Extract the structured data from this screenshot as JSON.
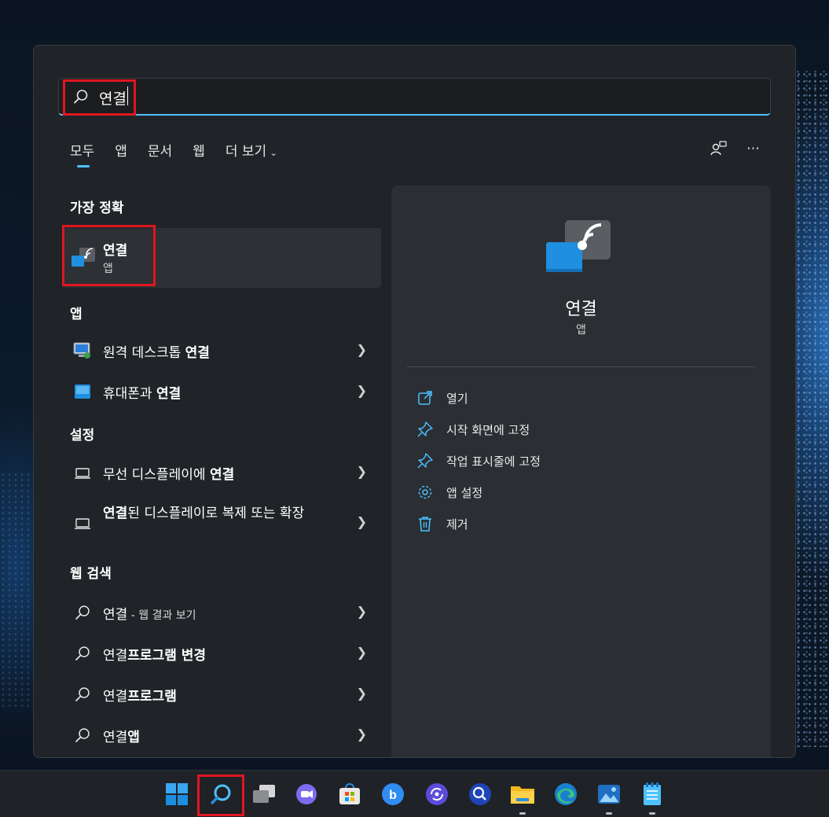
{
  "search": {
    "query": "연결"
  },
  "tabs": [
    {
      "label": "모두"
    },
    {
      "label": "앱"
    },
    {
      "label": "문서"
    },
    {
      "label": "웹"
    },
    {
      "label": "더 보기"
    }
  ],
  "best_match": {
    "heading": "가장 정확",
    "title": "연결",
    "subtitle": "앱"
  },
  "apps": {
    "heading": "앱",
    "items": [
      {
        "prefix": "원격 데스크톱 ",
        "bold": "연결"
      },
      {
        "prefix": "휴대폰과 ",
        "bold": "연결"
      }
    ]
  },
  "settings": {
    "heading": "설정",
    "items": [
      {
        "prefix": "무선 디스플레이에 ",
        "bold": "연결",
        "suffix": ""
      },
      {
        "prefix": "",
        "bold": "연결",
        "suffix": "된 디스플레이로 복제 또는 확장"
      }
    ]
  },
  "web": {
    "heading": "웹 검색",
    "items": [
      {
        "prefix": "연결",
        "bold": "",
        "small": " - 웹 결과 보기"
      },
      {
        "prefix": "연결",
        "bold": "프로그램 변경",
        "small": ""
      },
      {
        "prefix": "연결",
        "bold": "프로그램",
        "small": ""
      },
      {
        "prefix": "연결",
        "bold": "앱",
        "small": ""
      }
    ]
  },
  "detail": {
    "title": "연결",
    "subtitle": "앱",
    "actions": [
      {
        "label": "열기",
        "icon": "open-icon"
      },
      {
        "label": "시작 화면에 고정",
        "icon": "pin-icon"
      },
      {
        "label": "작업 표시줄에 고정",
        "icon": "pin-icon"
      },
      {
        "label": "앱 설정",
        "icon": "gear-icon"
      },
      {
        "label": "제거",
        "icon": "trash-icon"
      }
    ]
  },
  "colors": {
    "accent": "#4cc2ff",
    "highlight_box": "#e0161f",
    "panel": "#202327"
  },
  "taskbar": [
    {
      "name": "start-button",
      "icon": "windows-logo-icon"
    },
    {
      "name": "search-button",
      "icon": "search-icon"
    },
    {
      "name": "task-view-button",
      "icon": "task-view-icon"
    },
    {
      "name": "chat-button",
      "icon": "chat-icon"
    },
    {
      "name": "store-button",
      "icon": "store-icon"
    },
    {
      "name": "bing-button",
      "icon": "bing-icon"
    },
    {
      "name": "app-button",
      "icon": "sync-app-icon"
    },
    {
      "name": "app-button-2",
      "icon": "search-app-icon"
    },
    {
      "name": "file-explorer-button",
      "icon": "folder-icon"
    },
    {
      "name": "edge-button",
      "icon": "edge-icon"
    },
    {
      "name": "photos-button",
      "icon": "photos-icon"
    },
    {
      "name": "notepad-button",
      "icon": "notepad-icon"
    }
  ]
}
